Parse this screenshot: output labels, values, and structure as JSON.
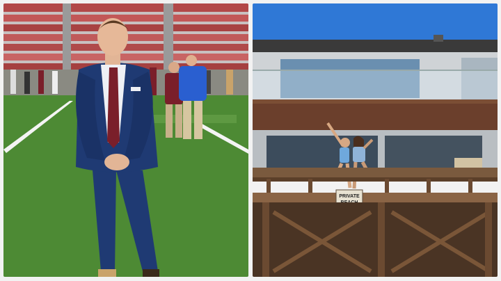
{
  "collage": {
    "left_photo": {
      "subject": "man-in-suit-on-football-field"
    },
    "right_photo": {
      "subject": "two-women-on-beach-house-balcony",
      "sign_lines": [
        "PRIVATE",
        "BEACH"
      ]
    }
  },
  "colors": {
    "turf": "#4d8a34",
    "suit": "#1f3a73",
    "sky": "#2f78d6",
    "wood": "#6b4a31",
    "stands": "#b04a4a"
  }
}
